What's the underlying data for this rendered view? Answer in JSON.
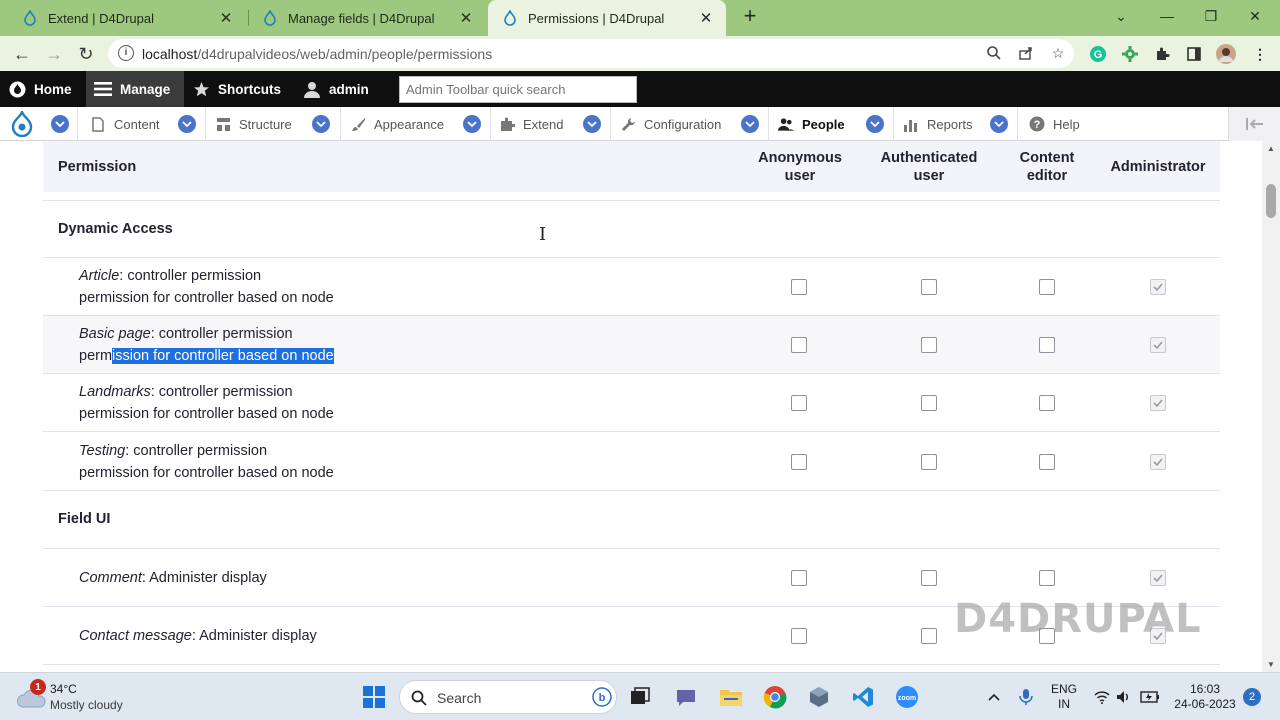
{
  "browser": {
    "tabs": [
      {
        "title": "Extend | D4Drupal",
        "active": false
      },
      {
        "title": "Manage fields | D4Drupal",
        "active": false
      },
      {
        "title": "Permissions | D4Drupal",
        "active": true
      }
    ],
    "url_host": "localhost",
    "url_path": "/d4drupalvideos/web/admin/people/permissions"
  },
  "toolbar": {
    "home": "Home",
    "manage": "Manage",
    "shortcuts": "Shortcuts",
    "user": "admin",
    "search_placeholder": "Admin Toolbar quick search"
  },
  "tray": {
    "items": [
      "Content",
      "Structure",
      "Appearance",
      "Extend",
      "Configuration",
      "People",
      "Reports",
      "Help"
    ],
    "active": "People"
  },
  "table": {
    "header": {
      "permission": "Permission",
      "roles": [
        {
          "line1": "Anonymous",
          "line2": "user"
        },
        {
          "line1": "Authenticated",
          "line2": "user"
        },
        {
          "line1": "Content",
          "line2": "editor"
        },
        {
          "line1": "Administrator",
          "line2": ""
        }
      ]
    },
    "groups": [
      {
        "name": "Dynamic Access",
        "permissions": [
          {
            "type": "Article",
            "title": ": controller permission",
            "description": "permission for controller based on node",
            "checked": [
              false,
              false,
              false,
              true
            ]
          },
          {
            "type": "Basic page",
            "title": ": controller permission",
            "description_pre": "perm",
            "description_selected": "ission for controller based on node",
            "checked": [
              false,
              false,
              false,
              true
            ]
          },
          {
            "type": "Landmarks",
            "title": ": controller permission",
            "description": "permission for controller based on node",
            "checked": [
              false,
              false,
              false,
              true
            ]
          },
          {
            "type": "Testing",
            "title": ": controller permission",
            "description": "permission for controller based on node",
            "checked": [
              false,
              false,
              false,
              true
            ]
          }
        ]
      },
      {
        "name": "Field UI",
        "permissions": [
          {
            "type": "Comment",
            "title": ": Administer display",
            "checked": [
              false,
              false,
              false,
              true
            ]
          },
          {
            "type": "Contact message",
            "title": ": Administer display",
            "checked": [
              false,
              false,
              false,
              true
            ]
          }
        ]
      }
    ]
  },
  "watermark": "D4DRUPAL",
  "taskbar": {
    "notification_count": "1",
    "temperature": "34°C",
    "weather": "Mostly cloudy",
    "search_label": "Search",
    "language_line1": "ENG",
    "language_line2": "IN",
    "time": "16:03",
    "date": "24-06-2023",
    "notif_badge": "2"
  },
  "colors": {
    "tab_bar": "#9ec77f",
    "address_bar": "#e9f3df",
    "toolbar_black": "#0f0f0f",
    "tray_chevron": "#4a74c9",
    "selection": "#1e6fe0"
  }
}
